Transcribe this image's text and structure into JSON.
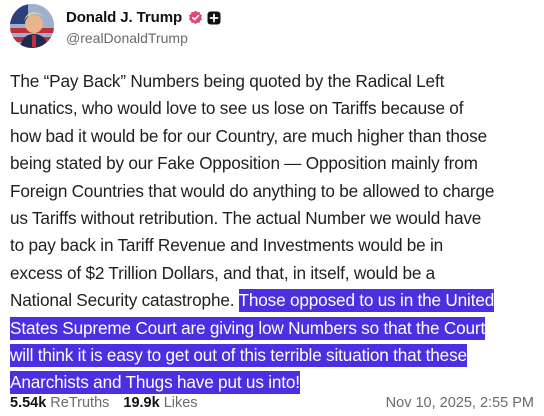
{
  "author": {
    "display_name": "Donald J. Trump",
    "handle": "@realDonaldTrump",
    "avatar_icon": "profile-photo",
    "verified_icon": "verified-badge-icon",
    "verified_color": "#e0457b",
    "platform_icon": "plus-square-icon"
  },
  "post": {
    "lines": [
      "The “Pay Back” Numbers being quoted by the Radical Left",
      "Lunatics, who would love to see us lose on Tariffs because of",
      "how bad it would be for our Country, are much higher than those",
      "being stated by our Fake Opposition — Opposition mainly from",
      "Foreign Countries that would do anything to be allowed to charge",
      "us Tariffs without retribution. The actual Number we would have",
      "to pay back in Tariff Revenue and Investments would be in",
      "excess of $2 Trillion Dollars, and that, in itself, would be a"
    ],
    "line9_plain": "National Security catastrophe. ",
    "line9_highlight": "Those opposed to us in the United",
    "highlight_lines": [
      "States Supreme Court are giving low Numbers so that the Court",
      "will think it is easy to get out of this terrible situation that these",
      "Anarchists and Thugs have put us into!"
    ],
    "highlight_color": "#4b2fe0"
  },
  "stats": {
    "retruths_count": "5.54k",
    "retruths_label": "ReTruths",
    "likes_count": "19.9k",
    "likes_label": "Likes",
    "timestamp": "Nov 10, 2025, 2:55 PM"
  }
}
